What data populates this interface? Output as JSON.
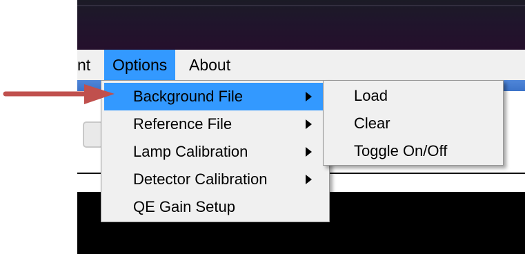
{
  "menubar": {
    "partial_item": "nt",
    "options": "Options",
    "about": "About"
  },
  "options_menu": {
    "items": [
      {
        "label": "Background File",
        "has_submenu": true,
        "highlighted": true
      },
      {
        "label": "Reference File",
        "has_submenu": true
      },
      {
        "label": "Lamp Calibration",
        "has_submenu": true
      },
      {
        "label": "Detector Calibration",
        "has_submenu": true
      },
      {
        "label": "QE Gain Setup",
        "has_submenu": false
      }
    ]
  },
  "background_file_submenu": {
    "items": [
      "Load",
      "Clear",
      "Toggle On/Off"
    ]
  },
  "colors": {
    "highlight": "#3399ff",
    "menu_bg": "#f0f0f0",
    "annotation_arrow": "#c0504d"
  },
  "icons": {
    "submenu_indicator": "submenu-arrow-icon",
    "annotation": "red-pointer-arrow-icon"
  }
}
